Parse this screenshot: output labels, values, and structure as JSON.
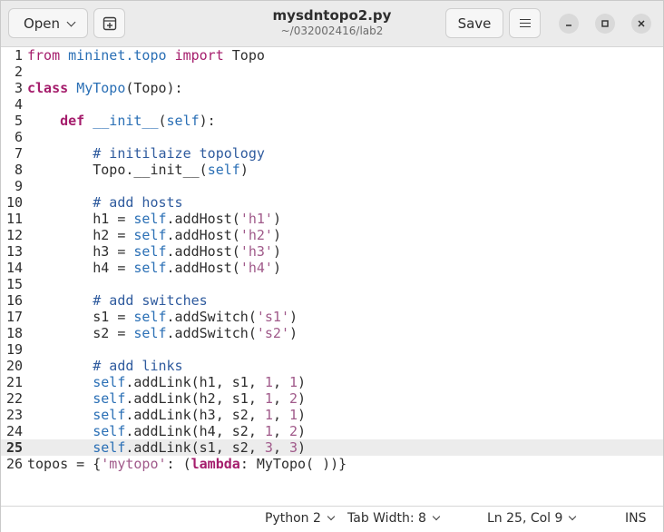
{
  "header": {
    "open_label": "Open",
    "title": "mysdntopo2.py",
    "subtitle": "~/032002416/lab2",
    "save_label": "Save"
  },
  "editor": {
    "current_line": 25,
    "lines": [
      {
        "n": "1",
        "tokens": [
          [
            "pp",
            "from"
          ],
          [
            "",
            " "
          ],
          [
            "id",
            "mininet.topo"
          ],
          [
            "",
            " "
          ],
          [
            "pp",
            "import"
          ],
          [
            "",
            " Topo"
          ]
        ]
      },
      {
        "n": "2",
        "tokens": []
      },
      {
        "n": "3",
        "tokens": [
          [
            "kw",
            "class"
          ],
          [
            "",
            " "
          ],
          [
            "id",
            "MyTopo"
          ],
          [
            "",
            "(Topo):"
          ]
        ]
      },
      {
        "n": "4",
        "tokens": []
      },
      {
        "n": "5",
        "tokens": [
          [
            "",
            "    "
          ],
          [
            "kw",
            "def"
          ],
          [
            "",
            " "
          ],
          [
            "id",
            "__init__"
          ],
          [
            "",
            "("
          ],
          [
            "self",
            "self"
          ],
          [
            "",
            "):"
          ]
        ]
      },
      {
        "n": "6",
        "tokens": []
      },
      {
        "n": "7",
        "tokens": [
          [
            "",
            "        "
          ],
          [
            "cm",
            "# initilaize topology"
          ]
        ]
      },
      {
        "n": "8",
        "tokens": [
          [
            "",
            "        Topo.__init__("
          ],
          [
            "self",
            "self"
          ],
          [
            "",
            ")"
          ]
        ]
      },
      {
        "n": "9",
        "tokens": []
      },
      {
        "n": "10",
        "tokens": [
          [
            "",
            "        "
          ],
          [
            "cm",
            "# add hosts"
          ]
        ]
      },
      {
        "n": "11",
        "tokens": [
          [
            "",
            "        h1 = "
          ],
          [
            "self",
            "self"
          ],
          [
            "",
            ".addHost("
          ],
          [
            "str",
            "'h1'"
          ],
          [
            "",
            ")"
          ]
        ]
      },
      {
        "n": "12",
        "tokens": [
          [
            "",
            "        h2 = "
          ],
          [
            "self",
            "self"
          ],
          [
            "",
            ".addHost("
          ],
          [
            "str",
            "'h2'"
          ],
          [
            "",
            ")"
          ]
        ]
      },
      {
        "n": "13",
        "tokens": [
          [
            "",
            "        h3 = "
          ],
          [
            "self",
            "self"
          ],
          [
            "",
            ".addHost("
          ],
          [
            "str",
            "'h3'"
          ],
          [
            "",
            ")"
          ]
        ]
      },
      {
        "n": "14",
        "tokens": [
          [
            "",
            "        h4 = "
          ],
          [
            "self",
            "self"
          ],
          [
            "",
            ".addHost("
          ],
          [
            "str",
            "'h4'"
          ],
          [
            "",
            ")"
          ]
        ]
      },
      {
        "n": "15",
        "tokens": []
      },
      {
        "n": "16",
        "tokens": [
          [
            "",
            "        "
          ],
          [
            "cm",
            "# add switches"
          ]
        ]
      },
      {
        "n": "17",
        "tokens": [
          [
            "",
            "        s1 = "
          ],
          [
            "self",
            "self"
          ],
          [
            "",
            ".addSwitch("
          ],
          [
            "str",
            "'s1'"
          ],
          [
            "",
            ")"
          ]
        ]
      },
      {
        "n": "18",
        "tokens": [
          [
            "",
            "        s2 = "
          ],
          [
            "self",
            "self"
          ],
          [
            "",
            ".addSwitch("
          ],
          [
            "str",
            "'s2'"
          ],
          [
            "",
            ")"
          ]
        ]
      },
      {
        "n": "19",
        "tokens": []
      },
      {
        "n": "20",
        "tokens": [
          [
            "",
            "        "
          ],
          [
            "cm",
            "# add links"
          ]
        ]
      },
      {
        "n": "21",
        "tokens": [
          [
            "",
            "        "
          ],
          [
            "self",
            "self"
          ],
          [
            "",
            ".addLink(h1, s1, "
          ],
          [
            "num",
            "1"
          ],
          [
            "",
            ", "
          ],
          [
            "num",
            "1"
          ],
          [
            "",
            ")"
          ]
        ]
      },
      {
        "n": "22",
        "tokens": [
          [
            "",
            "        "
          ],
          [
            "self",
            "self"
          ],
          [
            "",
            ".addLink(h2, s1, "
          ],
          [
            "num",
            "1"
          ],
          [
            "",
            ", "
          ],
          [
            "num",
            "2"
          ],
          [
            "",
            ")"
          ]
        ]
      },
      {
        "n": "23",
        "tokens": [
          [
            "",
            "        "
          ],
          [
            "self",
            "self"
          ],
          [
            "",
            ".addLink(h3, s2, "
          ],
          [
            "num",
            "1"
          ],
          [
            "",
            ", "
          ],
          [
            "num",
            "1"
          ],
          [
            "",
            ")"
          ]
        ]
      },
      {
        "n": "24",
        "tokens": [
          [
            "",
            "        "
          ],
          [
            "self",
            "self"
          ],
          [
            "",
            ".addLink(h4, s2, "
          ],
          [
            "num",
            "1"
          ],
          [
            "",
            ", "
          ],
          [
            "num",
            "2"
          ],
          [
            "",
            ")"
          ]
        ]
      },
      {
        "n": "25",
        "tokens": [
          [
            "",
            "        "
          ],
          [
            "self",
            "self"
          ],
          [
            "",
            ".addLink(s1, s2, "
          ],
          [
            "num",
            "3"
          ],
          [
            "",
            ", "
          ],
          [
            "num",
            "3"
          ],
          [
            "",
            ")"
          ]
        ]
      },
      {
        "n": "26",
        "tokens": [
          [
            "",
            "topos = {"
          ],
          [
            "str",
            "'mytopo'"
          ],
          [
            "",
            ": ("
          ],
          [
            "kw",
            "lambda"
          ],
          [
            "",
            ": MyTopo( ))}"
          ]
        ]
      }
    ]
  },
  "status": {
    "language": "Python 2",
    "tab_width": "Tab Width: 8",
    "position": "Ln 25, Col 9",
    "mode": "INS"
  },
  "icons": {
    "new_tab": "new-tab-icon",
    "menu": "hamburger-menu-icon",
    "minimize": "minimize-icon",
    "maximize": "maximize-icon",
    "close": "close-icon"
  }
}
